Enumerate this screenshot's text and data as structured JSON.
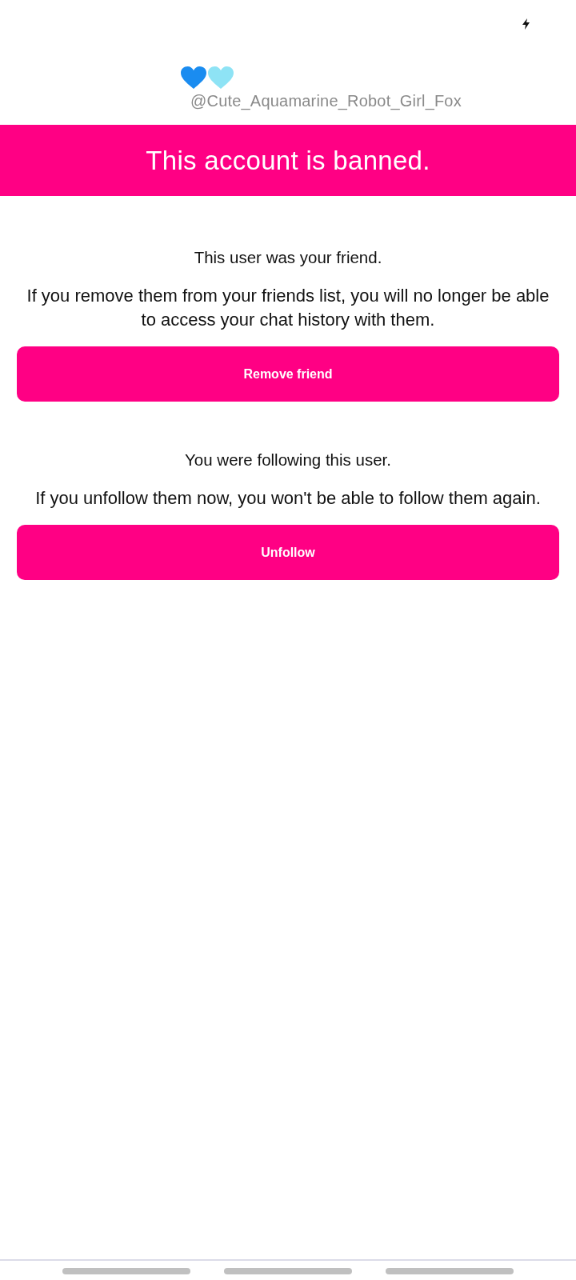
{
  "profile": {
    "hearts": [
      {
        "color": "#1a8cf0"
      },
      {
        "color": "#8ee3f5"
      }
    ],
    "username": "@Cute_Aquamarine_Robot_Girl_Fox"
  },
  "banner": {
    "title": "This account is banned."
  },
  "sections": [
    {
      "heading": "This user was your friend.",
      "note": "If you remove them from your friends list, you will no longer be able to access your chat history with them.",
      "button": "Remove friend"
    },
    {
      "heading": "You were following this user.",
      "note": "If you unfollow them now, you won't be able to follow them again.",
      "button": "Unfollow"
    }
  ]
}
